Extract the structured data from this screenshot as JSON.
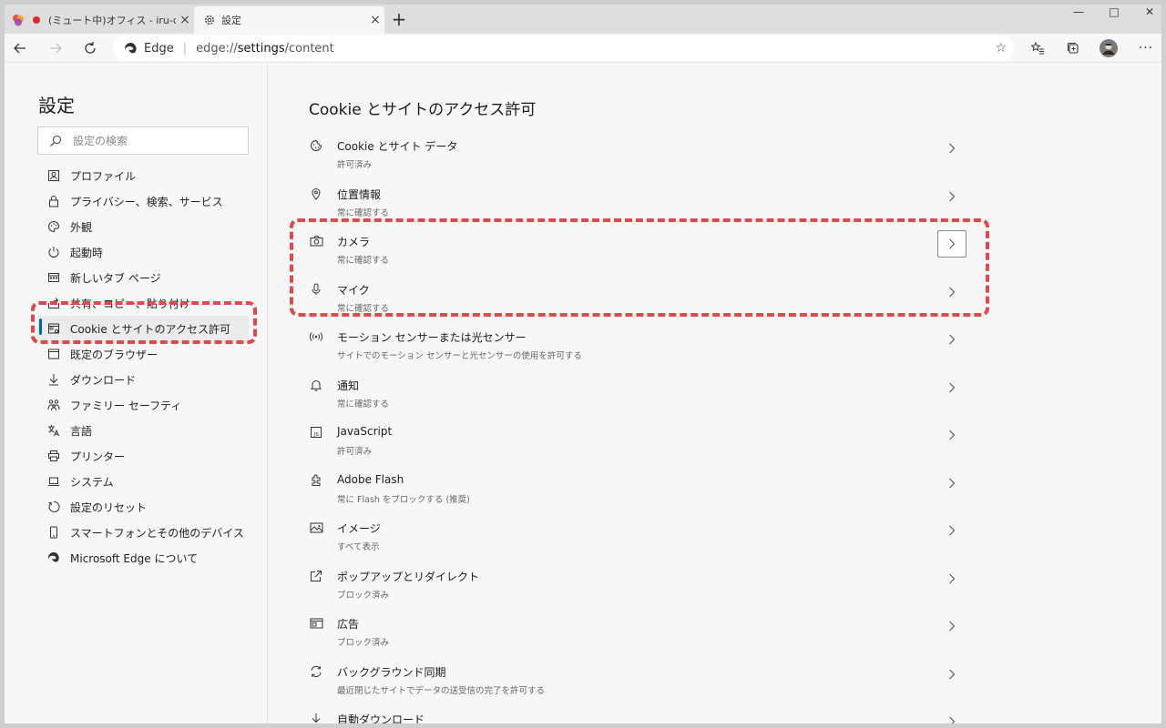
{
  "browser": {
    "tabs": [
      {
        "title": "(ミュート中)オフィス - iru-demo",
        "active": false
      },
      {
        "title": "設定",
        "active": true
      }
    ],
    "address": {
      "brand": "Edge",
      "separator": "|",
      "url_prefix": "edge://",
      "url_host": "settings",
      "url_path": "/content"
    }
  },
  "sidebar": {
    "title": "設定",
    "search_placeholder": "設定の検索",
    "items": [
      {
        "label": "プロファイル",
        "icon": "profile-icon"
      },
      {
        "label": "プライバシー、検索、サービス",
        "icon": "lock-icon"
      },
      {
        "label": "外観",
        "icon": "palette-icon"
      },
      {
        "label": "起動時",
        "icon": "power-icon"
      },
      {
        "label": "新しいタブ ページ",
        "icon": "new-tab-icon"
      },
      {
        "label": "共有、コピー、貼り付け",
        "icon": "share-icon"
      },
      {
        "label": "Cookie とサイトのアクセス許可",
        "icon": "site-permissions-icon",
        "selected": true
      },
      {
        "label": "既定のブラウザー",
        "icon": "default-browser-icon"
      },
      {
        "label": "ダウンロード",
        "icon": "download-icon"
      },
      {
        "label": "ファミリー セーフティ",
        "icon": "family-icon"
      },
      {
        "label": "言語",
        "icon": "language-icon"
      },
      {
        "label": "プリンター",
        "icon": "printer-icon"
      },
      {
        "label": "システム",
        "icon": "laptop-icon"
      },
      {
        "label": "設定のリセット",
        "icon": "reset-icon"
      },
      {
        "label": "スマートフォンとその他のデバイス",
        "icon": "phone-icon"
      },
      {
        "label": "Microsoft Edge について",
        "icon": "edge-logo-icon"
      }
    ]
  },
  "main": {
    "title": "Cookie とサイトのアクセス許可",
    "rows": [
      {
        "title": "Cookie とサイト データ",
        "subtitle": "許可済み",
        "icon": "cookie-icon"
      },
      {
        "title": "位置情報",
        "subtitle": "常に確認する",
        "icon": "location-icon"
      },
      {
        "title": "カメラ",
        "subtitle": "常に確認する",
        "icon": "camera-icon"
      },
      {
        "title": "マイク",
        "subtitle": "常に確認する",
        "icon": "microphone-icon"
      },
      {
        "title": "モーション センサーまたは光センサー",
        "subtitle": "サイトでのモーション センサーと光センサーの使用を許可する",
        "icon": "sensor-icon"
      },
      {
        "title": "通知",
        "subtitle": "常に確認する",
        "icon": "bell-icon"
      },
      {
        "title": "JavaScript",
        "subtitle": "許可済み",
        "icon": "javascript-icon"
      },
      {
        "title": "Adobe Flash",
        "subtitle": "常に Flash をブロックする (推奨)",
        "icon": "puzzle-icon"
      },
      {
        "title": "イメージ",
        "subtitle": "すべて表示",
        "icon": "image-icon"
      },
      {
        "title": "ポップアップとリダイレクト",
        "subtitle": "ブロック済み",
        "icon": "popup-icon"
      },
      {
        "title": "広告",
        "subtitle": "ブロック済み",
        "icon": "ads-icon"
      },
      {
        "title": "バックグラウンド同期",
        "subtitle": "最近閉じたサイトでデータの送受信の完了を許可する",
        "icon": "sync-icon"
      },
      {
        "title": "自動ダウンロード",
        "subtitle": "",
        "icon": "download-icon"
      }
    ]
  },
  "colors": {
    "annotation": "#de4a4a",
    "accent": "#0063b1"
  }
}
